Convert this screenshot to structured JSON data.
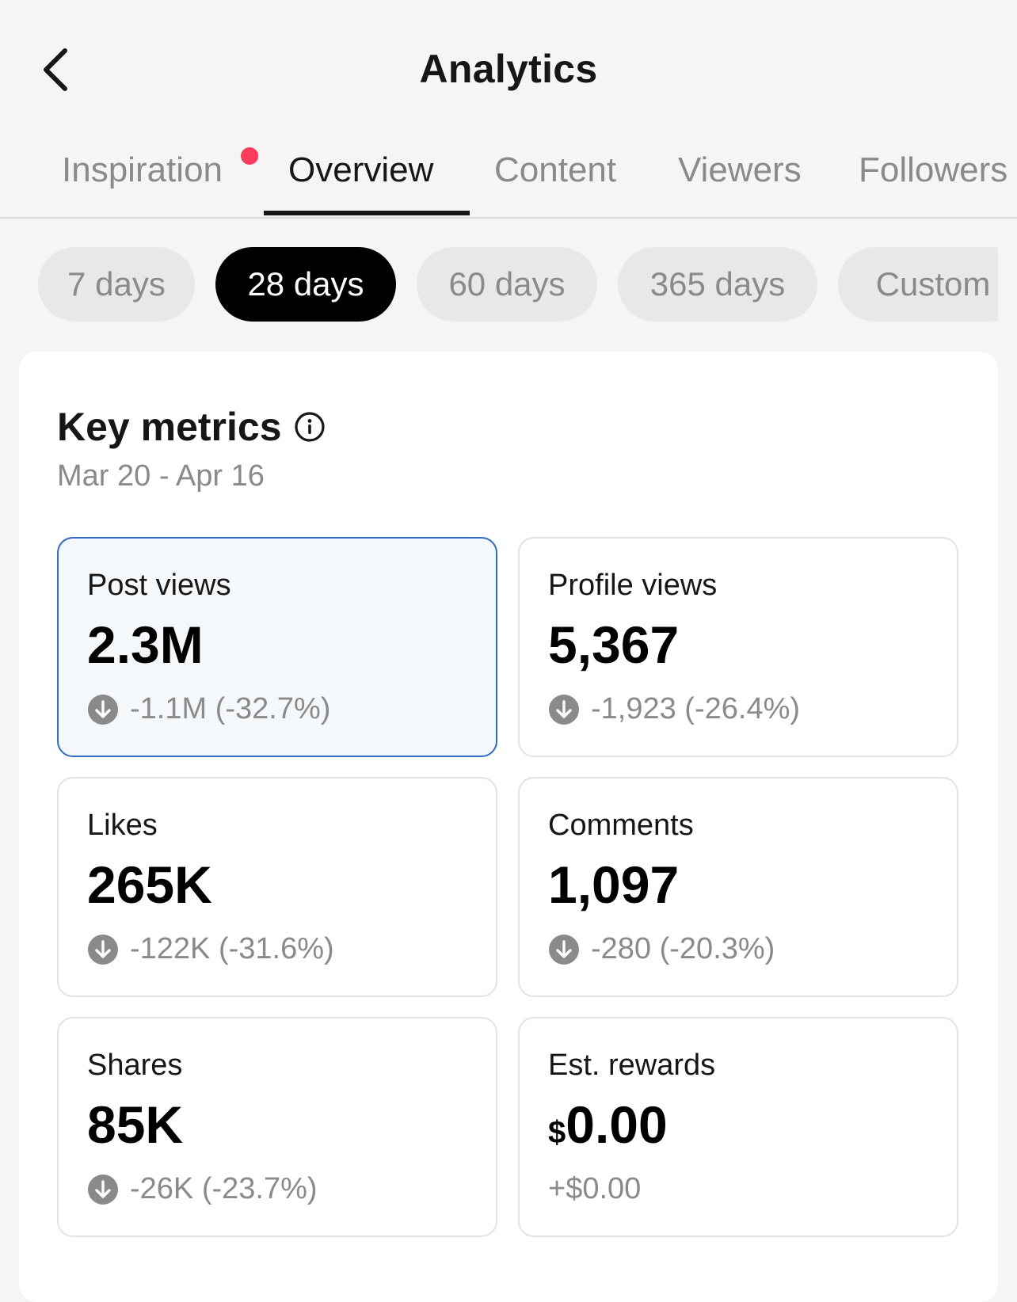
{
  "header": {
    "title": "Analytics"
  },
  "tabs": [
    {
      "label": "Inspiration",
      "badge": true
    },
    {
      "label": "Overview",
      "active": true
    },
    {
      "label": "Content"
    },
    {
      "label": "Viewers"
    },
    {
      "label": "Followers"
    }
  ],
  "ranges": [
    {
      "label": "7 days"
    },
    {
      "label": "28 days",
      "active": true
    },
    {
      "label": "60 days"
    },
    {
      "label": "365 days"
    },
    {
      "label": "Custom"
    }
  ],
  "key_metrics": {
    "title": "Key metrics",
    "date_range": "Mar 20 - Apr 16",
    "items": [
      {
        "label": "Post views",
        "value": "2.3M",
        "change": "-1.1M (-32.7%)",
        "trend": "down",
        "selected": true
      },
      {
        "label": "Profile views",
        "value": "5,367",
        "change": "-1,923 (-26.4%)",
        "trend": "down"
      },
      {
        "label": "Likes",
        "value": "265K",
        "change": "-122K (-31.6%)",
        "trend": "down"
      },
      {
        "label": "Comments",
        "value": "1,097",
        "change": "-280 (-20.3%)",
        "trend": "down"
      },
      {
        "label": "Shares",
        "value": "85K",
        "change": "-26K (-23.7%)",
        "trend": "down"
      },
      {
        "label": "Est. rewards",
        "currency": "$",
        "value": "0.00",
        "change": "+$0.00",
        "trend": "none"
      }
    ]
  },
  "colors": {
    "accent_border": "#2f6bc6",
    "badge": "#ff3b5c",
    "muted_text": "#8a8a8a"
  },
  "icons": {
    "back": "chevron-left-icon",
    "info": "info-icon",
    "trend_down": "arrow-down-circle-icon"
  }
}
